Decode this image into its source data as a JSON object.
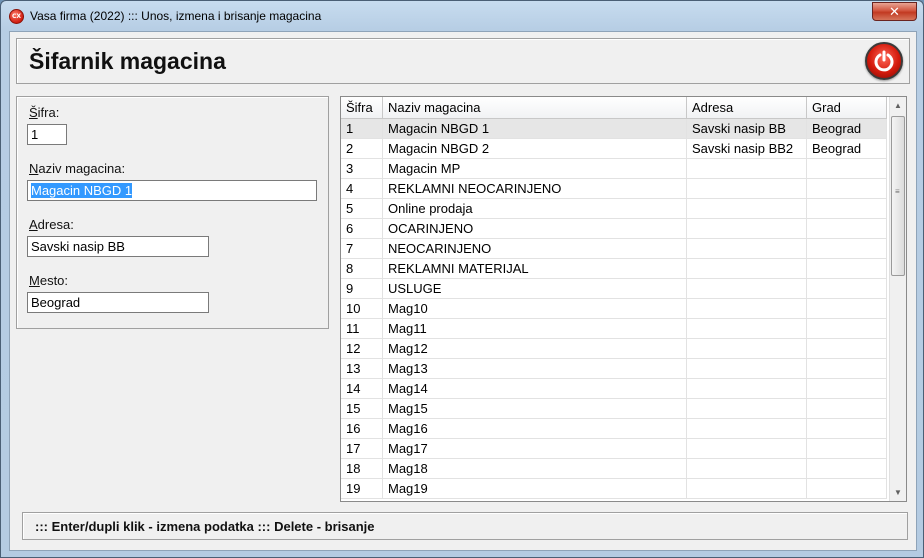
{
  "window": {
    "title": "Vasa firma (2022) ::: Unos, izmena i brisanje magacina",
    "app_icon_text": "CX",
    "close_glyph": "✕"
  },
  "header": {
    "title": "Šifarnik magacina",
    "power_icon": "power-icon",
    "power_color": "#d41a0c"
  },
  "form": {
    "sifra": {
      "label_first": "Š",
      "label_rest": "ifra:",
      "value": "1"
    },
    "naziv": {
      "label_first": "N",
      "label_rest": "aziv magacina:",
      "value": "Magacin NBGD 1"
    },
    "adresa": {
      "label_first": "A",
      "label_rest": "dresa:",
      "value": "Savski nasip BB"
    },
    "mesto": {
      "label_first": "M",
      "label_rest": "esto:",
      "value": "Beograd"
    }
  },
  "grid": {
    "columns": [
      "Šifra",
      "Naziv magacina",
      "Adresa",
      "Grad"
    ],
    "rows": [
      [
        "1",
        "Magacin NBGD 1",
        "Savski nasip BB",
        "Beograd"
      ],
      [
        "2",
        "Magacin NBGD 2",
        "Savski nasip BB2",
        "Beograd"
      ],
      [
        "3",
        "Magacin MP",
        "",
        ""
      ],
      [
        "4",
        "REKLAMNI NEOCARINJENO",
        "",
        ""
      ],
      [
        "5",
        "Online prodaja",
        "",
        ""
      ],
      [
        "6",
        "OCARINJENO",
        "",
        ""
      ],
      [
        "7",
        "NEOCARINJENO",
        "",
        ""
      ],
      [
        "8",
        "REKLAMNI MATERIJAL",
        "",
        ""
      ],
      [
        "9",
        "USLUGE",
        "",
        ""
      ],
      [
        "10",
        "Mag10",
        "",
        ""
      ],
      [
        "11",
        "Mag11",
        "",
        ""
      ],
      [
        "12",
        "Mag12",
        "",
        ""
      ],
      [
        "13",
        "Mag13",
        "",
        ""
      ],
      [
        "14",
        "Mag14",
        "",
        ""
      ],
      [
        "15",
        "Mag15",
        "",
        ""
      ],
      [
        "16",
        "Mag16",
        "",
        ""
      ],
      [
        "17",
        "Mag17",
        "",
        ""
      ],
      [
        "18",
        "Mag18",
        "",
        ""
      ],
      [
        "19",
        "Mag19",
        "",
        ""
      ]
    ],
    "selected_row": 0
  },
  "status": {
    "text": "::: Enter/dupli klik - izmena podatka ::: Delete - brisanje"
  }
}
